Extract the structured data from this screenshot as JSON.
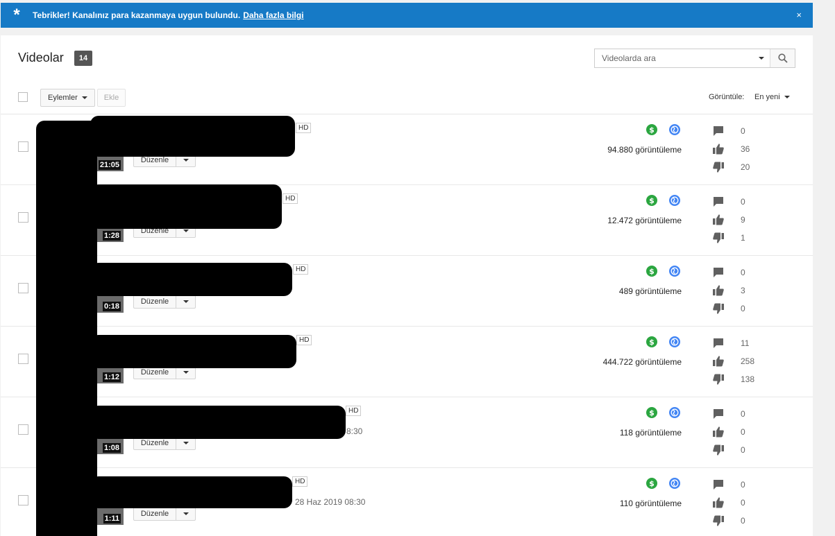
{
  "banner": {
    "message": "Tebrikler! Kanalınız para kazanmaya uygun bulundu.",
    "link": "Daha fazla bilgi",
    "close": "×",
    "color": "#167ac6"
  },
  "header": {
    "title": "Videolar",
    "count": "14",
    "search_placeholder": "Videolarda ara"
  },
  "toolbar": {
    "actions_label": "Eylemler",
    "add_label": "Ekle",
    "view_label": "Görüntüle:",
    "view_value": "En yeni"
  },
  "colors": {
    "monetized": "#2ba640",
    "public": "#4285f4",
    "icon_gray": "#606060"
  },
  "videos": [
    {
      "duration": "21:05",
      "hd": "HD",
      "date": "",
      "edit": "Düzenle",
      "views": "94.880 görüntüleme",
      "comments": "0",
      "likes": "36",
      "dislikes": "20"
    },
    {
      "duration": "1:28",
      "hd": "HD",
      "date": "",
      "edit": "Düzenle",
      "views": "12.472 görüntüleme",
      "comments": "0",
      "likes": "9",
      "dislikes": "1"
    },
    {
      "duration": "0:18",
      "hd": "HD",
      "date": "",
      "edit": "Düzenle",
      "views": "489 görüntüleme",
      "comments": "0",
      "likes": "3",
      "dislikes": "0"
    },
    {
      "duration": "1:12",
      "hd": "HD",
      "date": "",
      "edit": "Düzenle",
      "views": "444.722 görüntüleme",
      "comments": "11",
      "likes": "258",
      "dislikes": "138"
    },
    {
      "duration": "1:08",
      "hd": "HD",
      "date": "8:30",
      "edit": "Düzenle",
      "views": "118 görüntüleme",
      "comments": "0",
      "likes": "0",
      "dislikes": "0"
    },
    {
      "duration": "1:11",
      "hd": "HD",
      "date": "28 Haz 2019 08:30",
      "edit": "Düzenle",
      "views": "110 görüntüleme",
      "comments": "0",
      "likes": "0",
      "dislikes": "0"
    }
  ]
}
